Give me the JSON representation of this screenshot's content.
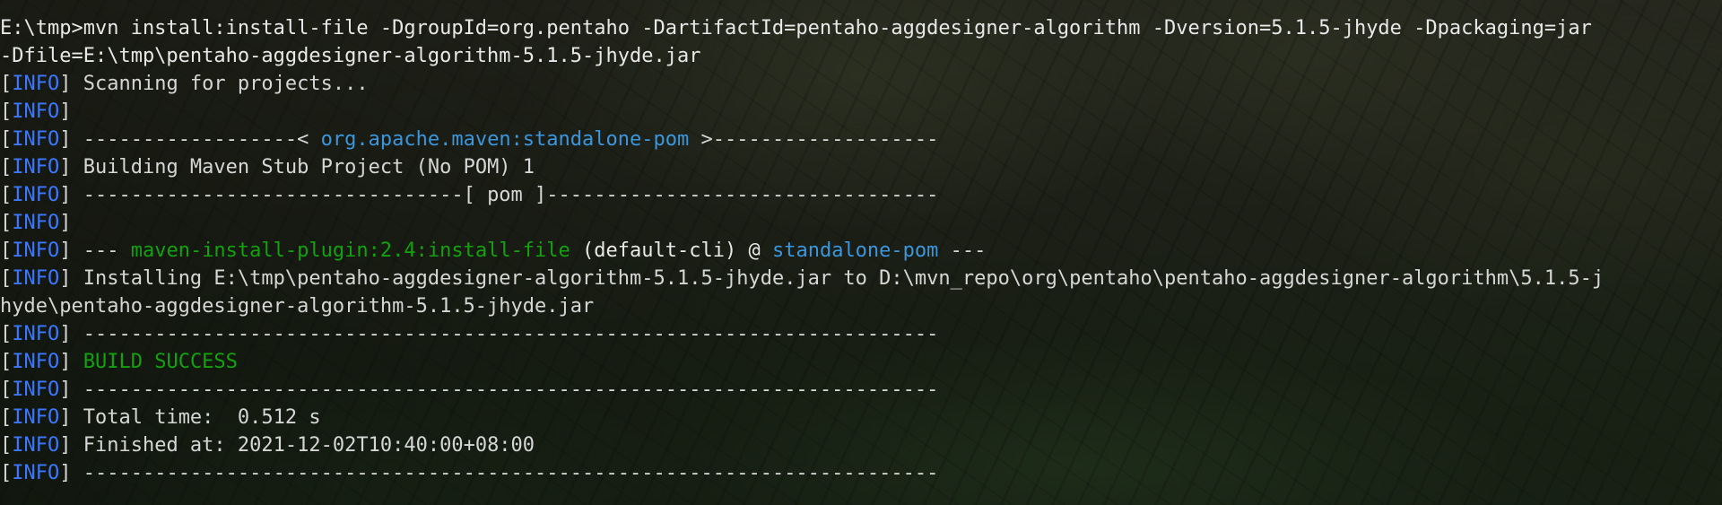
{
  "terminal": {
    "colors": {
      "text": "#d6d6d6",
      "info_tag": "#3b78ff",
      "artifact": "#3a96dd",
      "plugin": "#13a10e",
      "success": "#13a10e"
    },
    "command_line_1": "E:\\tmp>mvn install:install-file -DgroupId=org.pentaho -DartifactId=pentaho-aggdesigner-algorithm -Dversion=5.1.5-jhyde -Dpackaging=jar",
    "command_line_2": "-Dfile=E:\\tmp\\pentaho-aggdesigner-algorithm-5.1.5-jhyde.jar",
    "info_tag": "INFO",
    "bracket_open": "[",
    "bracket_close": "]",
    "scanning": " Scanning for projects...",
    "separator_left": " ------------------< ",
    "project_id": "org.apache.maven:standalone-pom",
    "separator_right": " >-------------------",
    "building": " Building Maven Stub Project (No POM) 1",
    "pom_line": " --------------------------------[ pom ]---------------------------------",
    "plugin_prefix": " --- ",
    "plugin_name": "maven-install-plugin:2.4:install-file",
    "plugin_middle": " (default-cli) @ ",
    "plugin_target": "standalone-pom",
    "plugin_suffix": " ---",
    "installing_1": " Installing E:\\tmp\\pentaho-aggdesigner-algorithm-5.1.5-jhyde.jar to D:\\mvn_repo\\org\\pentaho\\pentaho-aggdesigner-algorithm\\5.1.5-j",
    "installing_2": "hyde\\pentaho-aggdesigner-algorithm-5.1.5-jhyde.jar",
    "dash_line": " ------------------------------------------------------------------------",
    "build_success": "BUILD SUCCESS",
    "total_time": " Total time:  0.512 s",
    "finished_at": " Finished at: 2021-12-02T10:40:00+08:00"
  }
}
